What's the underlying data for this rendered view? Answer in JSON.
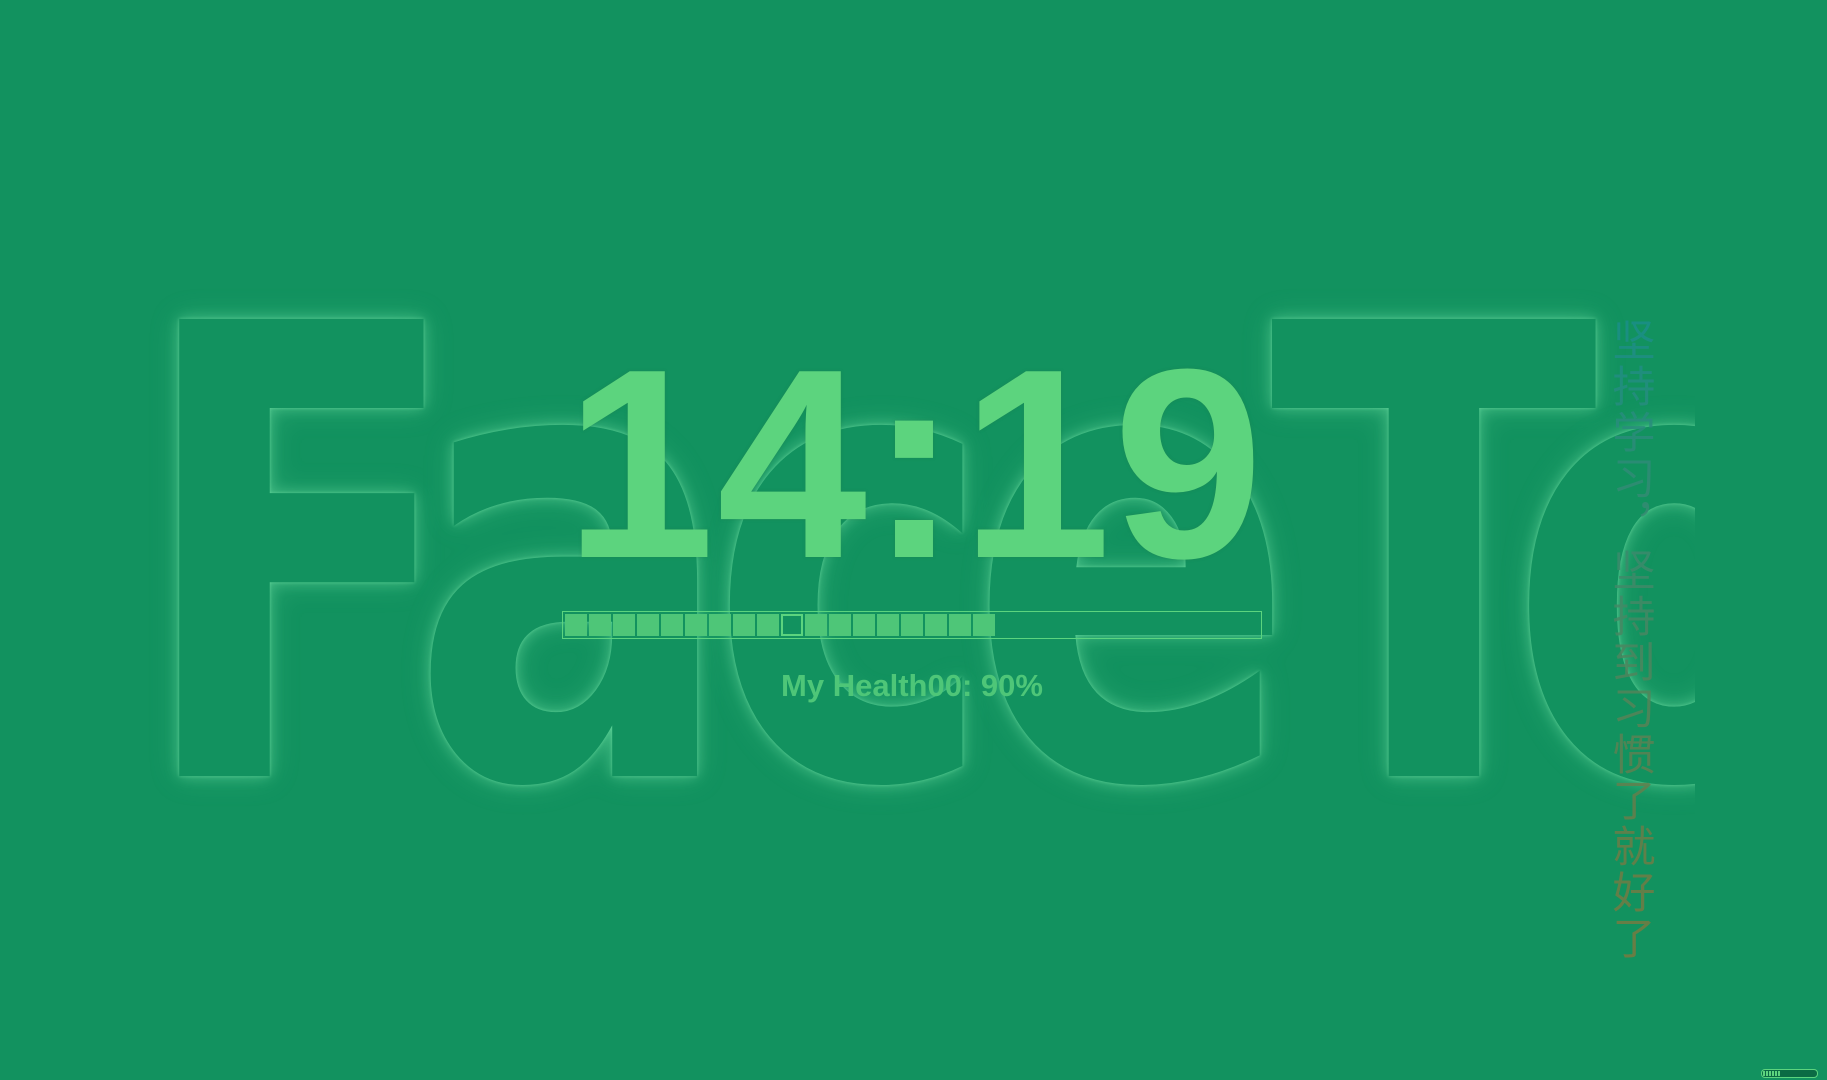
{
  "watermark": {
    "text": "FaceTop"
  },
  "clock": {
    "time": "14:19"
  },
  "health": {
    "label": "My Health00: 90%",
    "value": 0.9,
    "segments_total": 20,
    "hollow_segments": [
      10,
      19
    ]
  },
  "motivation": {
    "text": "坚持学习，坚持到习惯了就好了"
  },
  "tray": {
    "level": 0.3
  },
  "colors": {
    "background": "#12925f",
    "accent": "#5cd47e",
    "segment_fill": "#4ec678"
  }
}
